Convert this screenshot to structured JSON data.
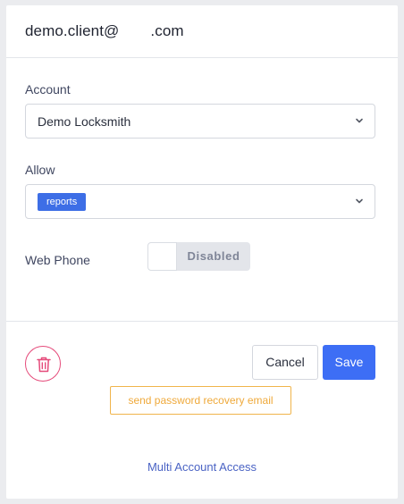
{
  "user": {
    "email_local": "demo.client@",
    "email_domain": ".com"
  },
  "account": {
    "label": "Account",
    "value": "Demo Locksmith"
  },
  "allow": {
    "label": "Allow",
    "tags": [
      "reports"
    ]
  },
  "web_phone": {
    "label": "Web Phone",
    "state": "Disabled"
  },
  "actions": {
    "cancel_label": "Cancel",
    "save_label": "Save",
    "recovery_label": "send password recovery email",
    "multi_account_label": "Multi Account Access"
  },
  "icons": {
    "delete": "trash-icon",
    "dropdown": "chevron-down-icon"
  },
  "colors": {
    "primary": "#3d6ef5",
    "danger": "#e54a7a",
    "warning": "#efa93a",
    "link": "#4a63c4"
  }
}
